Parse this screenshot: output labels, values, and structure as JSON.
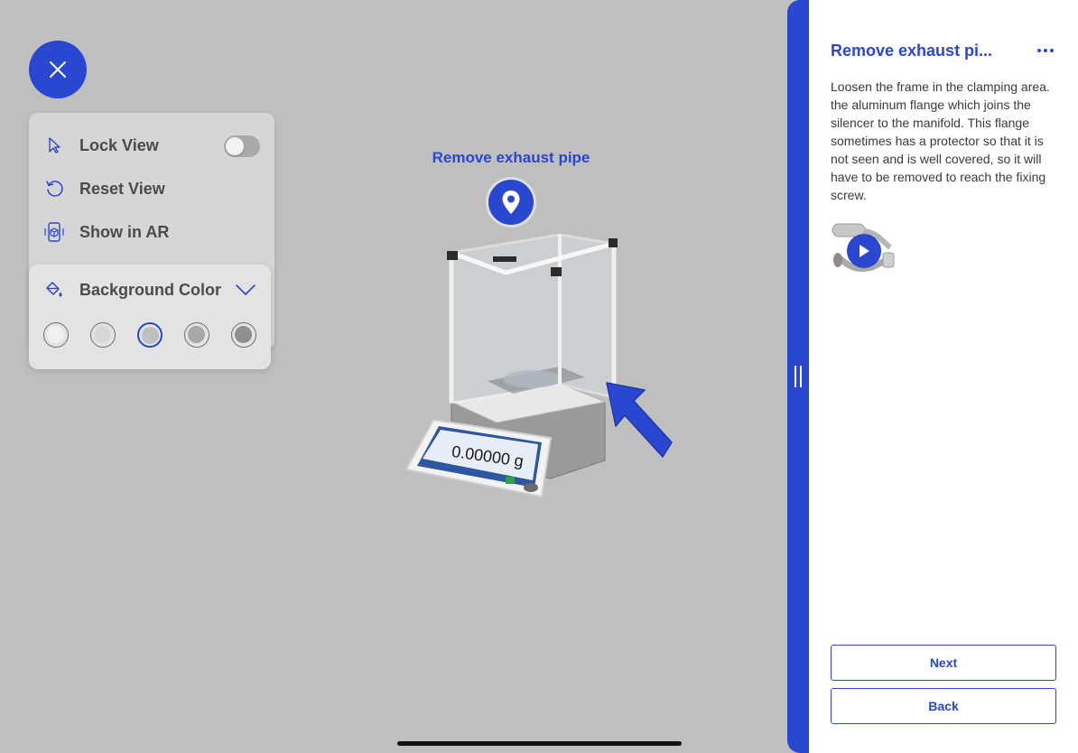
{
  "viewer": {
    "close_icon": "close-icon",
    "menu": {
      "lock_view": {
        "label": "Lock View",
        "icon": "cursor-arrow-icon",
        "toggle_on": false
      },
      "reset_view": {
        "label": "Reset View",
        "icon": "reset-rotate-icon"
      },
      "show_in_ar": {
        "label": "Show in AR",
        "icon": "ar-cube-icon"
      }
    },
    "background_color": {
      "label": "Background Color",
      "icon": "paint-bucket-icon",
      "expand_icon": "chevron-down-icon",
      "swatches": [
        "#f0f0f0",
        "#d7d7d7",
        "#bfbfbf",
        "#a8a8a8",
        "#8f8f8f"
      ],
      "selected_index": 2
    },
    "scene": {
      "annotation_label": "Remove exhaust pipe",
      "pin_icon": "location-pin-icon",
      "model_display_value": "0.00000 g",
      "arrow_icon": "arrow-indicator-icon"
    }
  },
  "side_panel": {
    "title": "Remove exhaust pi...",
    "more_icon": "more-horizontal-icon",
    "description": "Loosen the frame in the clamping area. the aluminum flange which joins the silencer to the manifold. This flange sometimes has a protector so that it is not seen and is well covered, so it will have to be removed to reach the fixing screw.",
    "video_icon": "play-icon",
    "next_label": "Next",
    "back_label": "Back"
  },
  "colors": {
    "accent": "#2a47d1",
    "viewport_background": "#bfbfbf",
    "panel_background": "#ffffff"
  }
}
